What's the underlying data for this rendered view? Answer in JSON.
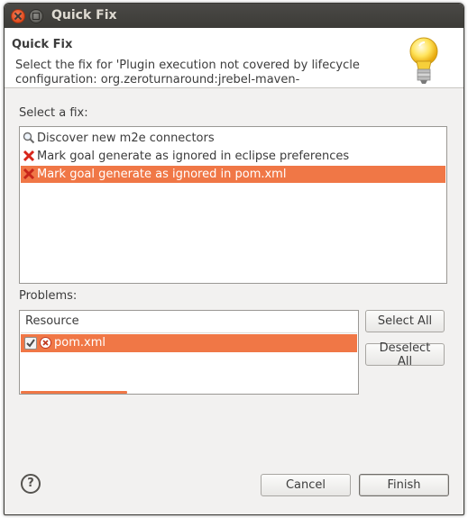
{
  "window": {
    "title": "Quick Fix"
  },
  "header": {
    "title": "Quick Fix",
    "message": "Select the fix for 'Plugin execution not covered by lifecycle configuration: org.zeroturnaround:jrebel-maven-"
  },
  "fixes": {
    "label": "Select a fix:",
    "items": [
      {
        "label": "Discover new m2e connectors",
        "icon": "search-icon",
        "selected": false
      },
      {
        "label": "Mark goal generate as ignored in eclipse preferences",
        "icon": "delete-x-icon",
        "selected": false
      },
      {
        "label": "Mark goal generate as ignored in pom.xml",
        "icon": "delete-x-icon",
        "selected": true
      }
    ]
  },
  "problems": {
    "label": "Problems:",
    "column_header": "Resource",
    "rows": [
      {
        "label": "pom.xml",
        "checked": true,
        "icon": "error-icon",
        "selected": true
      }
    ]
  },
  "buttons": {
    "select_all": "Select All",
    "deselect_all": "Deselect All",
    "cancel": "Cancel",
    "finish": "Finish",
    "help": "?"
  },
  "colors": {
    "selection": "#f07746",
    "titlebar": "#3c3b37"
  }
}
